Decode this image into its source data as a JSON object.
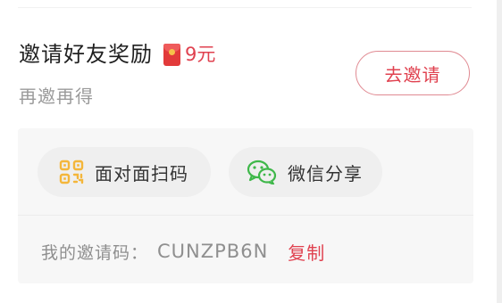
{
  "invite_reward": {
    "title": "邀请好友奖励",
    "amount": "9元",
    "subtitle": "再邀再得",
    "invite_button_label": "去邀请"
  },
  "share_options": [
    {
      "label": "面对面扫码",
      "icon": "qr-code-icon"
    },
    {
      "label": "微信分享",
      "icon": "wechat-icon"
    }
  ],
  "invite_code": {
    "label": "我的邀请码：",
    "value": "CUNZPB6N",
    "copy_label": "复制"
  },
  "colors": {
    "accent": "#e0414f",
    "qr_icon": "#f4b63a",
    "wechat_icon": "#3fb84a",
    "panel_background": "#f7f7f7"
  }
}
